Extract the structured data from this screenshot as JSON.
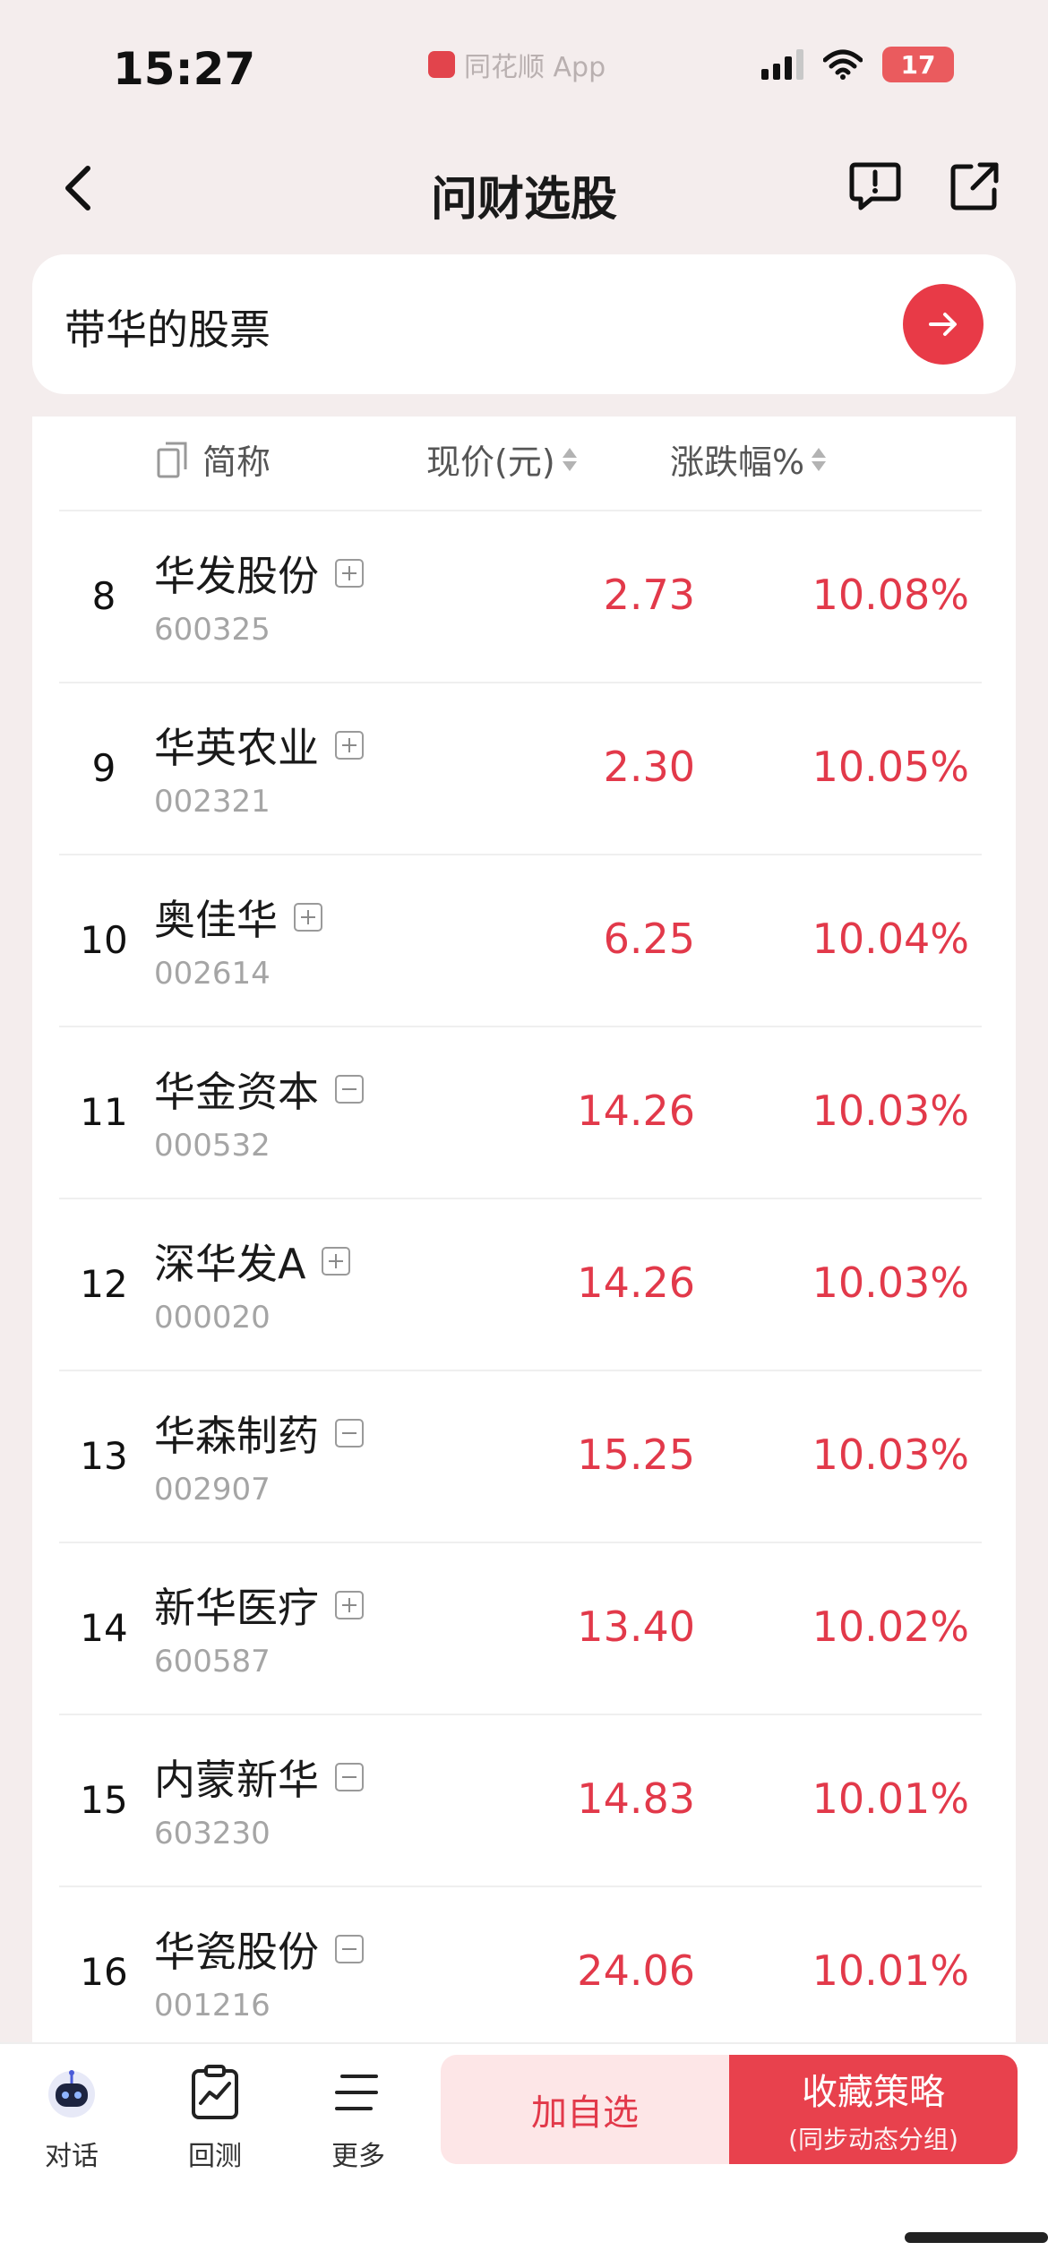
{
  "status_bar": {
    "time": "15:27",
    "source_app": "同花顺 App",
    "battery": "17"
  },
  "nav": {
    "title": "问财选股"
  },
  "query": {
    "text": "带华的股票"
  },
  "table": {
    "headers": {
      "name": "简称",
      "price": "现价(元)",
      "change": "涨跌幅%"
    },
    "rows": [
      {
        "rank": "8",
        "name": "华发股份",
        "code": "600325",
        "price": "2.73",
        "change": "10.08%",
        "toggle": "plus"
      },
      {
        "rank": "9",
        "name": "华英农业",
        "code": "002321",
        "price": "2.30",
        "change": "10.05%",
        "toggle": "plus"
      },
      {
        "rank": "10",
        "name": "奥佳华",
        "code": "002614",
        "price": "6.25",
        "change": "10.04%",
        "toggle": "plus"
      },
      {
        "rank": "11",
        "name": "华金资本",
        "code": "000532",
        "price": "14.26",
        "change": "10.03%",
        "toggle": "minus"
      },
      {
        "rank": "12",
        "name": "深华发A",
        "code": "000020",
        "price": "14.26",
        "change": "10.03%",
        "toggle": "plus"
      },
      {
        "rank": "13",
        "name": "华森制药",
        "code": "002907",
        "price": "15.25",
        "change": "10.03%",
        "toggle": "minus"
      },
      {
        "rank": "14",
        "name": "新华医疗",
        "code": "600587",
        "price": "13.40",
        "change": "10.02%",
        "toggle": "plus"
      },
      {
        "rank": "15",
        "name": "内蒙新华",
        "code": "603230",
        "price": "14.83",
        "change": "10.01%",
        "toggle": "minus"
      },
      {
        "rank": "16",
        "name": "华瓷股份",
        "code": "001216",
        "price": "24.06",
        "change": "10.01%",
        "toggle": "minus"
      }
    ]
  },
  "bottom_bar": {
    "tabs": [
      {
        "label": "对话",
        "icon": "robot-icon"
      },
      {
        "label": "回测",
        "icon": "backtest-chart-icon"
      },
      {
        "label": "更多",
        "icon": "menu-icon"
      }
    ],
    "add_watch": "加自选",
    "save_strategy": "收藏策略",
    "save_strategy_sub": "(同步动态分组)"
  },
  "colors": {
    "accent": "#e83a47",
    "rise": "#e2394a",
    "background": "#f4eded"
  }
}
